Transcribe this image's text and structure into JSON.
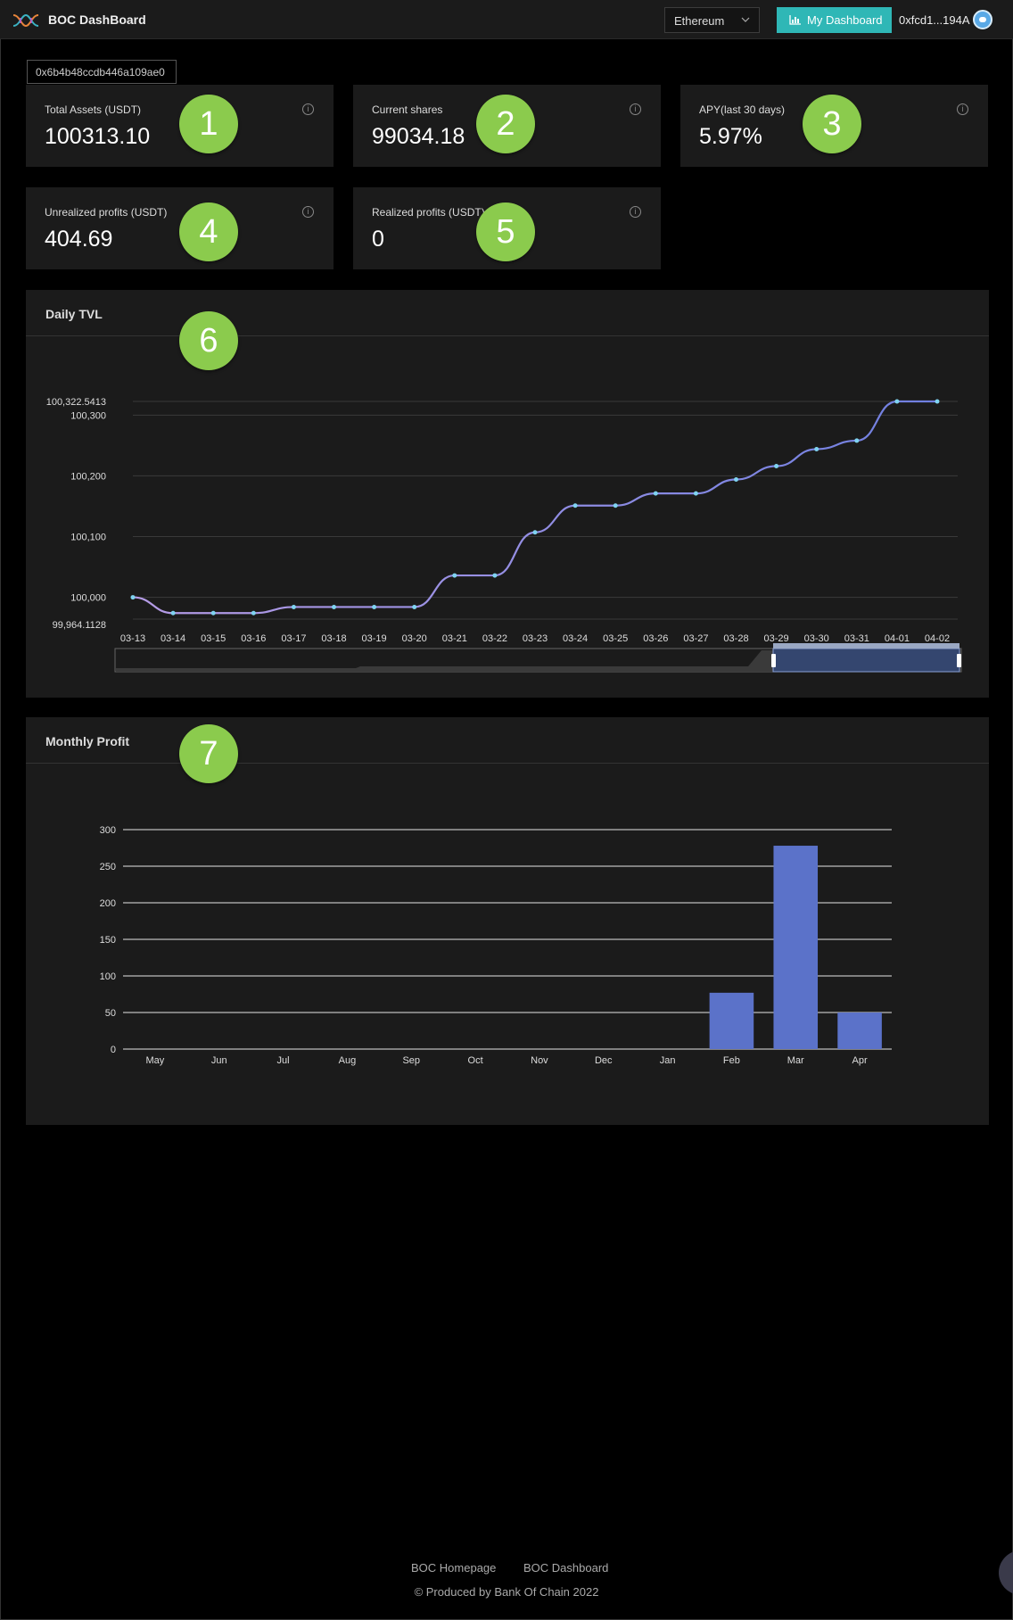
{
  "header": {
    "app_title": "BOC DashBoard",
    "network": "Ethereum",
    "dashboard_button": "My Dashboard",
    "wallet": "0xfcd1...194A"
  },
  "address": "0x6b4b48ccdb446a109ae0",
  "stats": [
    {
      "label": "Total Assets (USDT)",
      "value": "100313.10",
      "badge": "1"
    },
    {
      "label": "Current shares",
      "value": "99034.18",
      "badge": "2"
    },
    {
      "label": "APY(last 30 days)",
      "value": "5.97%",
      "badge": "3"
    },
    {
      "label": "Unrealized profits (USDT)",
      "value": "404.69",
      "badge": "4"
    },
    {
      "label": "Realized profits (USDT)",
      "value": "0",
      "badge": "5"
    }
  ],
  "daily_tvl": {
    "title": "Daily TVL",
    "badge": "6"
  },
  "monthly_profit": {
    "title": "Monthly Profit",
    "badge": "7"
  },
  "chart_data": [
    {
      "type": "line",
      "title": "Daily TVL",
      "x": [
        "03-13",
        "03-14",
        "03-15",
        "03-16",
        "03-17",
        "03-18",
        "03-19",
        "03-20",
        "03-21",
        "03-22",
        "03-23",
        "03-24",
        "03-25",
        "03-26",
        "03-27",
        "03-28",
        "03-29",
        "03-30",
        "03-31",
        "04-01",
        "04-02"
      ],
      "values": [
        100000,
        99974,
        99974,
        99974,
        99984,
        99984,
        99984,
        99984,
        100036,
        100036,
        100107,
        100151,
        100151,
        100171,
        100171,
        100194,
        100216,
        100244,
        100258,
        100322.5413,
        100322.5413
      ],
      "ylim": [
        99964.1128,
        100322.5413
      ],
      "yticks": [
        100000,
        100100,
        100200,
        100300
      ],
      "ytick_labels": [
        "100,000",
        "100,100",
        "100,200",
        "100,300"
      ],
      "ymin_label": "99,964.1128",
      "ymax_label": "100,322.5413",
      "grid": true,
      "line_color": "#6f7fe0",
      "has_zoom_slider": true
    },
    {
      "type": "bar",
      "title": "Monthly Profit",
      "categories": [
        "May",
        "Jun",
        "Jul",
        "Aug",
        "Sep",
        "Oct",
        "Nov",
        "Dec",
        "Jan",
        "Feb",
        "Mar",
        "Apr"
      ],
      "values": [
        0,
        0,
        0,
        0,
        0,
        0,
        0,
        0,
        0,
        77,
        278,
        50
      ],
      "ylim": [
        0,
        300
      ],
      "yticks": [
        0,
        50,
        100,
        150,
        200,
        250,
        300
      ],
      "grid": true,
      "bar_color": "#5b72c9"
    }
  ],
  "footer": {
    "homepage_link": "BOC Homepage",
    "dashboard_link": "BOC Dashboard",
    "copyright": "© Produced by Bank Of Chain 2022"
  },
  "colors": {
    "accent": "#2fb7b6",
    "badge": "#8bcb4d",
    "card_bg": "#1b1b1b"
  }
}
